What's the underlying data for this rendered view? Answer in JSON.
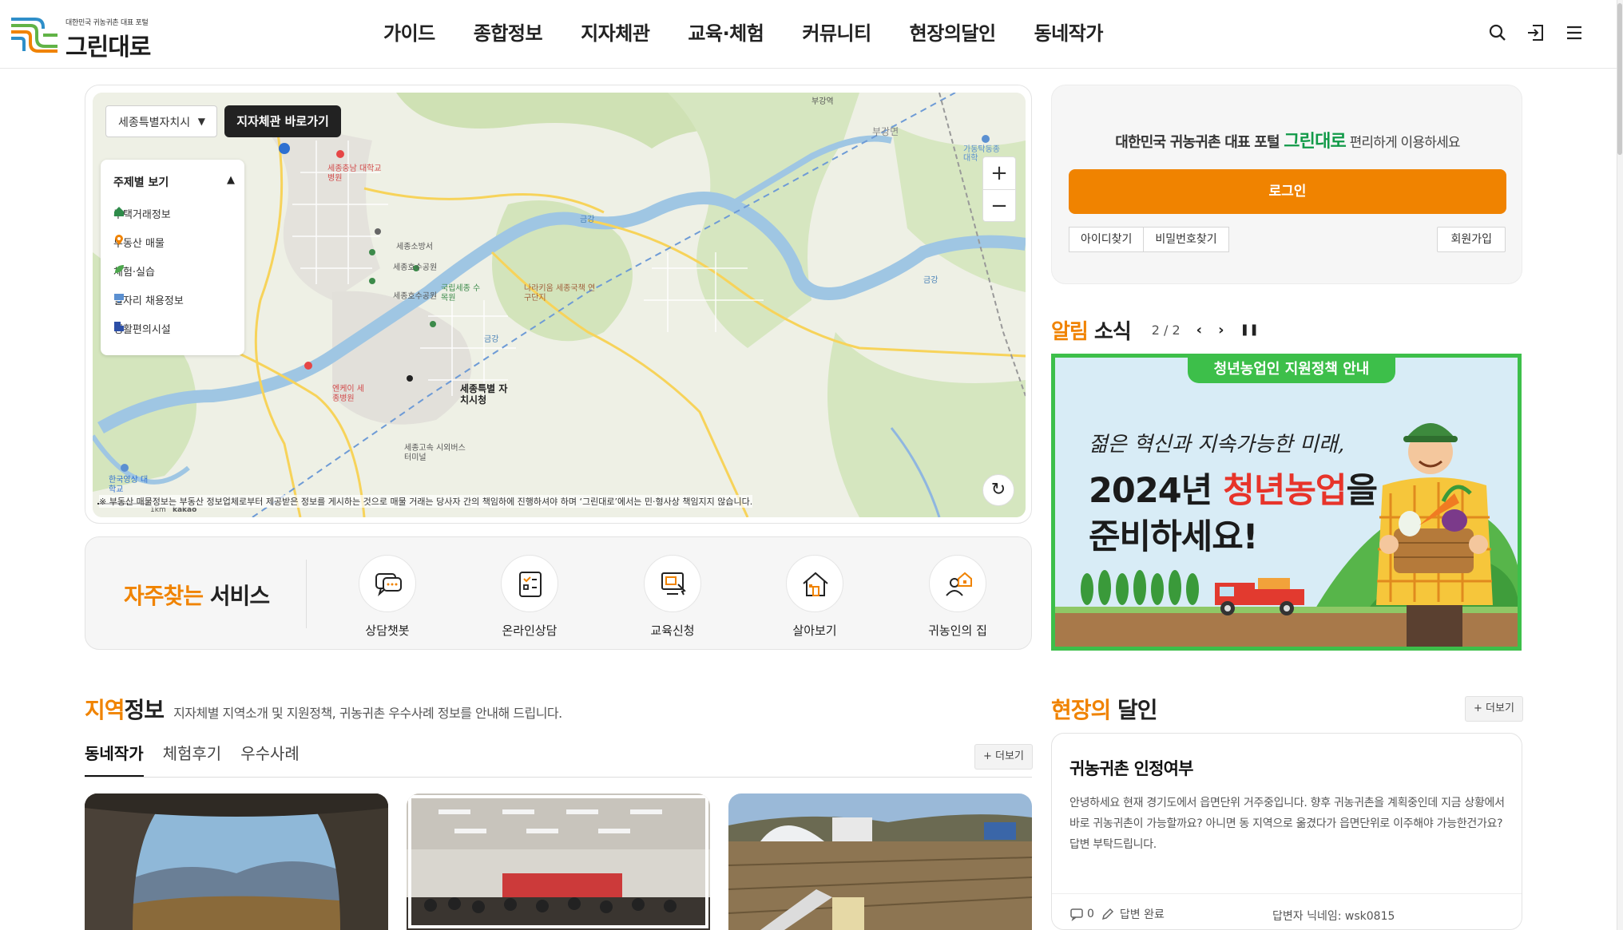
{
  "header": {
    "logo_small": "대한민국 귀농귀촌 대표 포털",
    "logo_text": "그린대로",
    "nav": [
      "가이드",
      "종합정보",
      "지자체관",
      "교육·체험",
      "커뮤니티",
      "현장의달인",
      "동네작가"
    ]
  },
  "map": {
    "region_select": "세종특별자치시",
    "go_button": "지자체관 바로가기",
    "theme_title": "주제별 보기",
    "themes": [
      "주택거래정보",
      "부동산 매물",
      "체험·실습",
      "일자리 채용정보",
      "생활편의시설"
    ],
    "labels": [
      "세종충남 대학교병원",
      "세종소방서",
      "세종호수공원",
      "세종호수공원",
      "국립세종 수목원",
      "나라키움 세종국책 연구단지",
      "세종특별 자치시청",
      "엔케이 세종병원",
      "세종고속 시외버스터미널",
      "한국영상 대학교",
      "부강역",
      "부강면",
      "금강",
      "금강",
      "금강",
      "가동탁동종 대학",
      "1km",
      "kakao"
    ],
    "notice": "※ 부동산 매물정보는 부동산 정보업체로부터 제공받은 정보를 게시하는 것으로 매물 거래는 당사자 간의 책임하에 진행하셔야 하며 ‘그린대로’에서는 민·형사상 책임지지 않습니다."
  },
  "services": {
    "title_accent": "자주찾는",
    "title_rest": " 서비스",
    "items": [
      "상담챗봇",
      "온라인상담",
      "교육신청",
      "살아보기",
      "귀농인의 집"
    ]
  },
  "login": {
    "msg_pre": "대한민국 귀농귀촌 대표 포털 ",
    "msg_brand": "그린대로",
    "msg_post": " 편리하게 이용하세요",
    "login_button": "로그인",
    "find_id": "아이디찾기",
    "find_pw": "비밀번호찾기",
    "join": "회원가입"
  },
  "notice": {
    "title_accent": "알림",
    "title_rest": " 소식",
    "pager": "2 / 2",
    "banner_tag": "청년농업인 지원정책 안내",
    "banner_hand": "젊은 혁신과 지속가능한 미래,",
    "banner_line1_pre": "2024년 ",
    "banner_line1_red": "청년농업",
    "banner_line1_post": "을",
    "banner_line2": "준비하세요!"
  },
  "region": {
    "title_accent": "지역",
    "title_rest": "정보",
    "desc": "지자체별 지역소개 및 지원정책, 귀농귀촌 우수사례 정보를 안내해 드립니다.",
    "tabs": [
      "동네작가",
      "체험후기",
      "우수사례"
    ],
    "more": "+ 더보기"
  },
  "field": {
    "title_accent": "현장의",
    "title_rest": " 달인",
    "more": "+ 더보기",
    "qa_title": "귀농귀촌 인정여부",
    "qa_body": "안녕하세요 현재 경기도에서 읍면단위 거주중입니다. 향후 귀농귀촌을 계획중인데 지금 상황에서 바로 귀농귀촌이 가능할까요? 아니면 동 지역으로 옮겼다가 읍면단위로 이주해야 가능한건가요? 답변 부탁드립니다.",
    "comment_count": "0",
    "status": "답변 완료",
    "answerer": "답변자 닉네임:  wsk0815"
  },
  "colors": {
    "accent": "#f08300",
    "brand_green": "#119a48",
    "banner_green": "#3dbf4a"
  }
}
